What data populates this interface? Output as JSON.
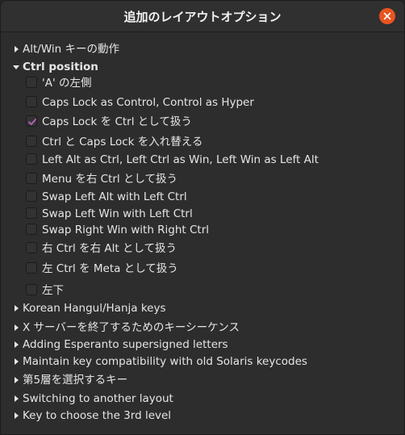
{
  "window": {
    "title": "追加のレイアウトオプション",
    "accent_color": "#e95420",
    "check_color": "#b460b3"
  },
  "tree": {
    "alt_win": "Alt/Win キーの動作",
    "ctrl_position": "Ctrl position",
    "ctrl_options": [
      {
        "label": "'A' の左側",
        "checked": false
      },
      {
        "label": "Caps Lock as Control, Control as Hyper",
        "checked": false
      },
      {
        "label": "Caps Lock を Ctrl として扱う",
        "checked": true
      },
      {
        "label": "Ctrl と Caps Lock を入れ替える",
        "checked": false
      },
      {
        "label": "Left Alt as Ctrl, Left Ctrl as Win, Left Win as Left Alt",
        "checked": false
      },
      {
        "label": "Menu を右 Ctrl として扱う",
        "checked": false
      },
      {
        "label": "Swap Left Alt with Left Ctrl",
        "checked": false
      },
      {
        "label": "Swap Left Win with Left Ctrl",
        "checked": false
      },
      {
        "label": "Swap Right Win with Right Ctrl",
        "checked": false
      },
      {
        "label": "右 Ctrl を右 Alt として扱う",
        "checked": false
      },
      {
        "label": "左 Ctrl を Meta として扱う",
        "checked": false
      },
      {
        "label": "左下",
        "checked": false
      }
    ],
    "korean": "Korean Hangul/Hanja keys",
    "x_server": "X サーバーを終了するためのキーシーケンス",
    "esperanto": "Adding Esperanto supersigned letters",
    "solaris": "Maintain key compatibility with old Solaris keycodes",
    "level5": "第5層を選択するキー",
    "switching": "Switching to another layout",
    "level3": "Key to choose the 3rd level"
  },
  "icons": {
    "close": "close-icon",
    "collapsed": "expander-collapsed-icon",
    "expanded": "expander-expanded-icon",
    "check": "check-icon"
  }
}
